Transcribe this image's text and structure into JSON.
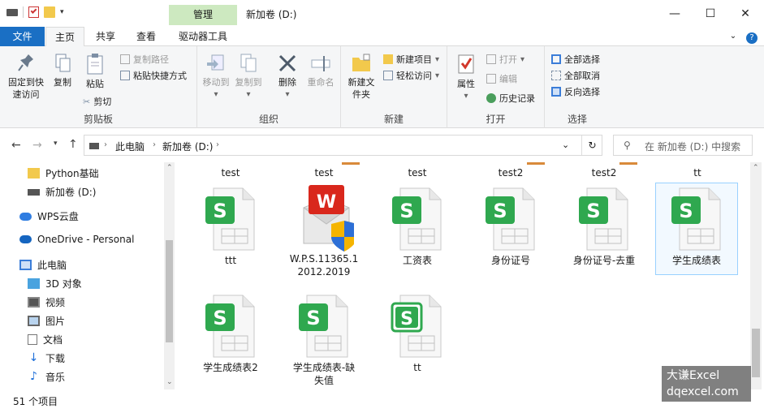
{
  "window": {
    "title": "新加卷 (D:)",
    "context_tab": "管理"
  },
  "tabs": {
    "file": "文件",
    "home": "主页",
    "share": "共享",
    "view": "查看",
    "drive_tools": "驱动器工具"
  },
  "ribbon": {
    "clipboard": {
      "label": "剪贴板",
      "pin": "固定到快速访问",
      "copy": "复制",
      "paste": "粘贴",
      "copy_path": "复制路径",
      "paste_shortcut": "粘贴快捷方式",
      "cut": "剪切"
    },
    "organize": {
      "label": "组织",
      "move_to": "移动到",
      "copy_to": "复制到",
      "delete": "删除",
      "rename": "重命名"
    },
    "new": {
      "label": "新建",
      "new_folder": "新建文件夹",
      "new_item": "新建项目",
      "easy_access": "轻松访问"
    },
    "open": {
      "label": "打开",
      "properties": "属性",
      "open": "打开",
      "edit": "编辑",
      "history": "历史记录"
    },
    "select": {
      "label": "选择",
      "select_all": "全部选择",
      "select_none": "全部取消",
      "invert": "反向选择"
    }
  },
  "address": {
    "crumbs": [
      "此电脑",
      "新加卷 (D:)"
    ],
    "search_placeholder": "在 新加卷 (D:) 中搜索"
  },
  "nav": {
    "items": [
      "Python基础",
      "新加卷 (D:)",
      "WPS云盘",
      "OneDrive - Personal",
      "此电脑",
      "3D 对象",
      "视频",
      "图片",
      "文档",
      "下载",
      "音乐"
    ]
  },
  "files": {
    "top_labels": [
      "test",
      "test",
      "test",
      "test2",
      "test2",
      "tt"
    ],
    "items": [
      {
        "name": "ttt",
        "type": "sheet"
      },
      {
        "name": "W.P.S.11365.12012.2019",
        "type": "installer"
      },
      {
        "name": "工资表",
        "type": "sheet"
      },
      {
        "name": "身份证号",
        "type": "sheet"
      },
      {
        "name": "身份证号-去重",
        "type": "sheet"
      },
      {
        "name": "学生成绩表",
        "type": "sheet",
        "selected": true
      },
      {
        "name": "学生成绩表2",
        "type": "sheet"
      },
      {
        "name": "学生成绩表-缺失值",
        "type": "sheet"
      },
      {
        "name": "tt",
        "type": "sheet-outline"
      }
    ]
  },
  "status": {
    "count": "51 个项目"
  },
  "watermark": {
    "line1": "大谦Excel",
    "line2": "dqexcel.com"
  },
  "colors": {
    "accent": "#1a6fc4",
    "sheet_green": "#2fa84f",
    "context_green": "#cde9c0"
  }
}
